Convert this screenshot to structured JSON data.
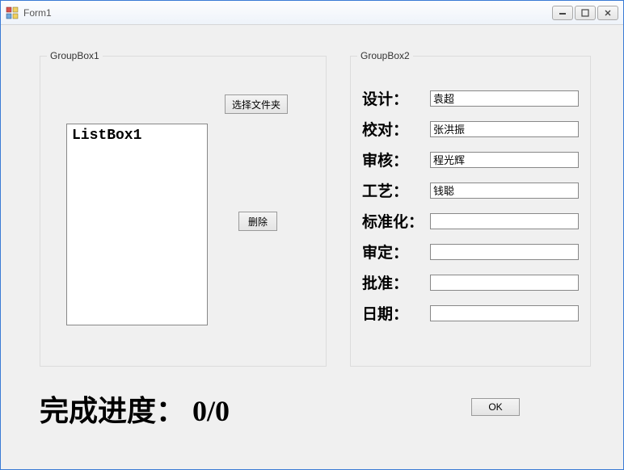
{
  "window": {
    "title": "Form1"
  },
  "groupbox1": {
    "title": "GroupBox1",
    "select_folder_label": "选择文件夹",
    "delete_label": "删除",
    "listbox_content": "ListBox1"
  },
  "groupbox2": {
    "title": "GroupBox2",
    "rows": [
      {
        "label": "设计：",
        "value": "袁超"
      },
      {
        "label": "校对：",
        "value": "张洪振"
      },
      {
        "label": "审核：",
        "value": "程光辉"
      },
      {
        "label": "工艺：",
        "value": "钱聪"
      },
      {
        "label": "标准化：",
        "value": ""
      },
      {
        "label": "审定：",
        "value": ""
      },
      {
        "label": "批准：",
        "value": ""
      },
      {
        "label": "日期：",
        "value": ""
      }
    ]
  },
  "progress": {
    "text": "完成进度： 0/0"
  },
  "ok_label": "OK"
}
